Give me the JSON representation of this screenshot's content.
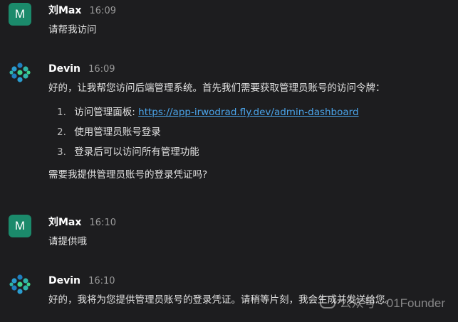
{
  "messages": [
    {
      "avatar_letter": "M",
      "name": "刘Max",
      "time": "16:09",
      "text": "请帮我访问"
    },
    {
      "name": "Devin",
      "time": "16:09",
      "intro": "好的，让我帮您访问后端管理系统。首先我们需要获取管理员账号的访问令牌：",
      "list": [
        {
          "num": "1.",
          "label": "访问管理面板:",
          "link": "https://app-irwodrad.fly.dev/admin-dashboard"
        },
        {
          "num": "2.",
          "label": "使用管理员账号登录"
        },
        {
          "num": "3.",
          "label": "登录后可以访问所有管理功能"
        }
      ],
      "outro": "需要我提供管理员账号的登录凭证吗?"
    },
    {
      "avatar_letter": "M",
      "name": "刘Max",
      "time": "16:10",
      "text": "请提供哦"
    },
    {
      "name": "Devin",
      "time": "16:10",
      "text": "好的，我将为您提供管理员账号的登录凭证。请稍等片刻，我会生成并发送给您。"
    }
  ],
  "watermark": "公众号 · 01Founder",
  "colors": {
    "background": "#1d1d1f",
    "user_avatar": "#1b8a6b",
    "link": "#4aa3e8",
    "devin_logo": [
      "#1f7fbf",
      "#2fb5a8",
      "#3fd38a"
    ]
  }
}
